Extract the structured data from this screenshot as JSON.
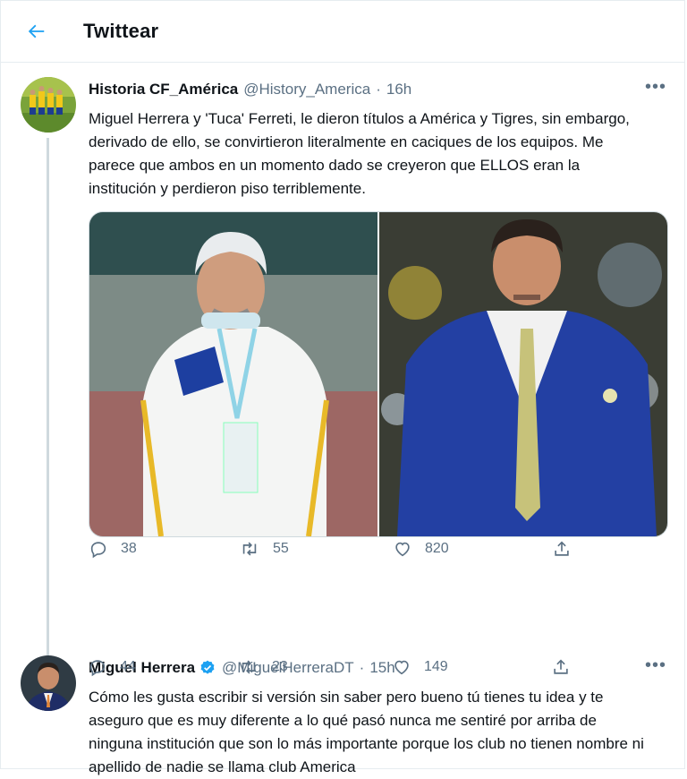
{
  "header": {
    "title": "Twittear",
    "back_icon": "arrow-left-icon",
    "accent": "#1da1f2"
  },
  "tweets": [
    {
      "name": "Historia CF_América",
      "handle": "@History_America",
      "separator": "·",
      "time": "16h",
      "text": "Miguel Herrera y 'Tuca' Ferreti, le dieron títulos a América y Tigres, sin embargo, derivado de ello, se convirtieron literalmente en caciques de los equipos. Me parece que ambos en un momento dado se creyeron que ELLOS eran la institución y perdieron piso terriblemente.",
      "more": "•••",
      "media": [
        "photo-left-coach",
        "photo-right-coach"
      ],
      "replies": "38",
      "retweets": "55",
      "likes": "820"
    },
    {
      "name": "Miguel Herrera",
      "verified": true,
      "handle": "@MiguelHerreraDT",
      "separator": "·",
      "time": "15h",
      "text": "Cómo les gusta escribir si versión sin saber pero bueno tú tienes tu idea y te aseguro que es muy diferente a lo qué pasó nunca me sentiré por arriba de ninguna institución que son lo más importante porque los club no tienen nombre ni apellido de nadie se llama club America",
      "more": "•••",
      "replies": "44",
      "retweets": "23",
      "likes": "149"
    }
  ]
}
